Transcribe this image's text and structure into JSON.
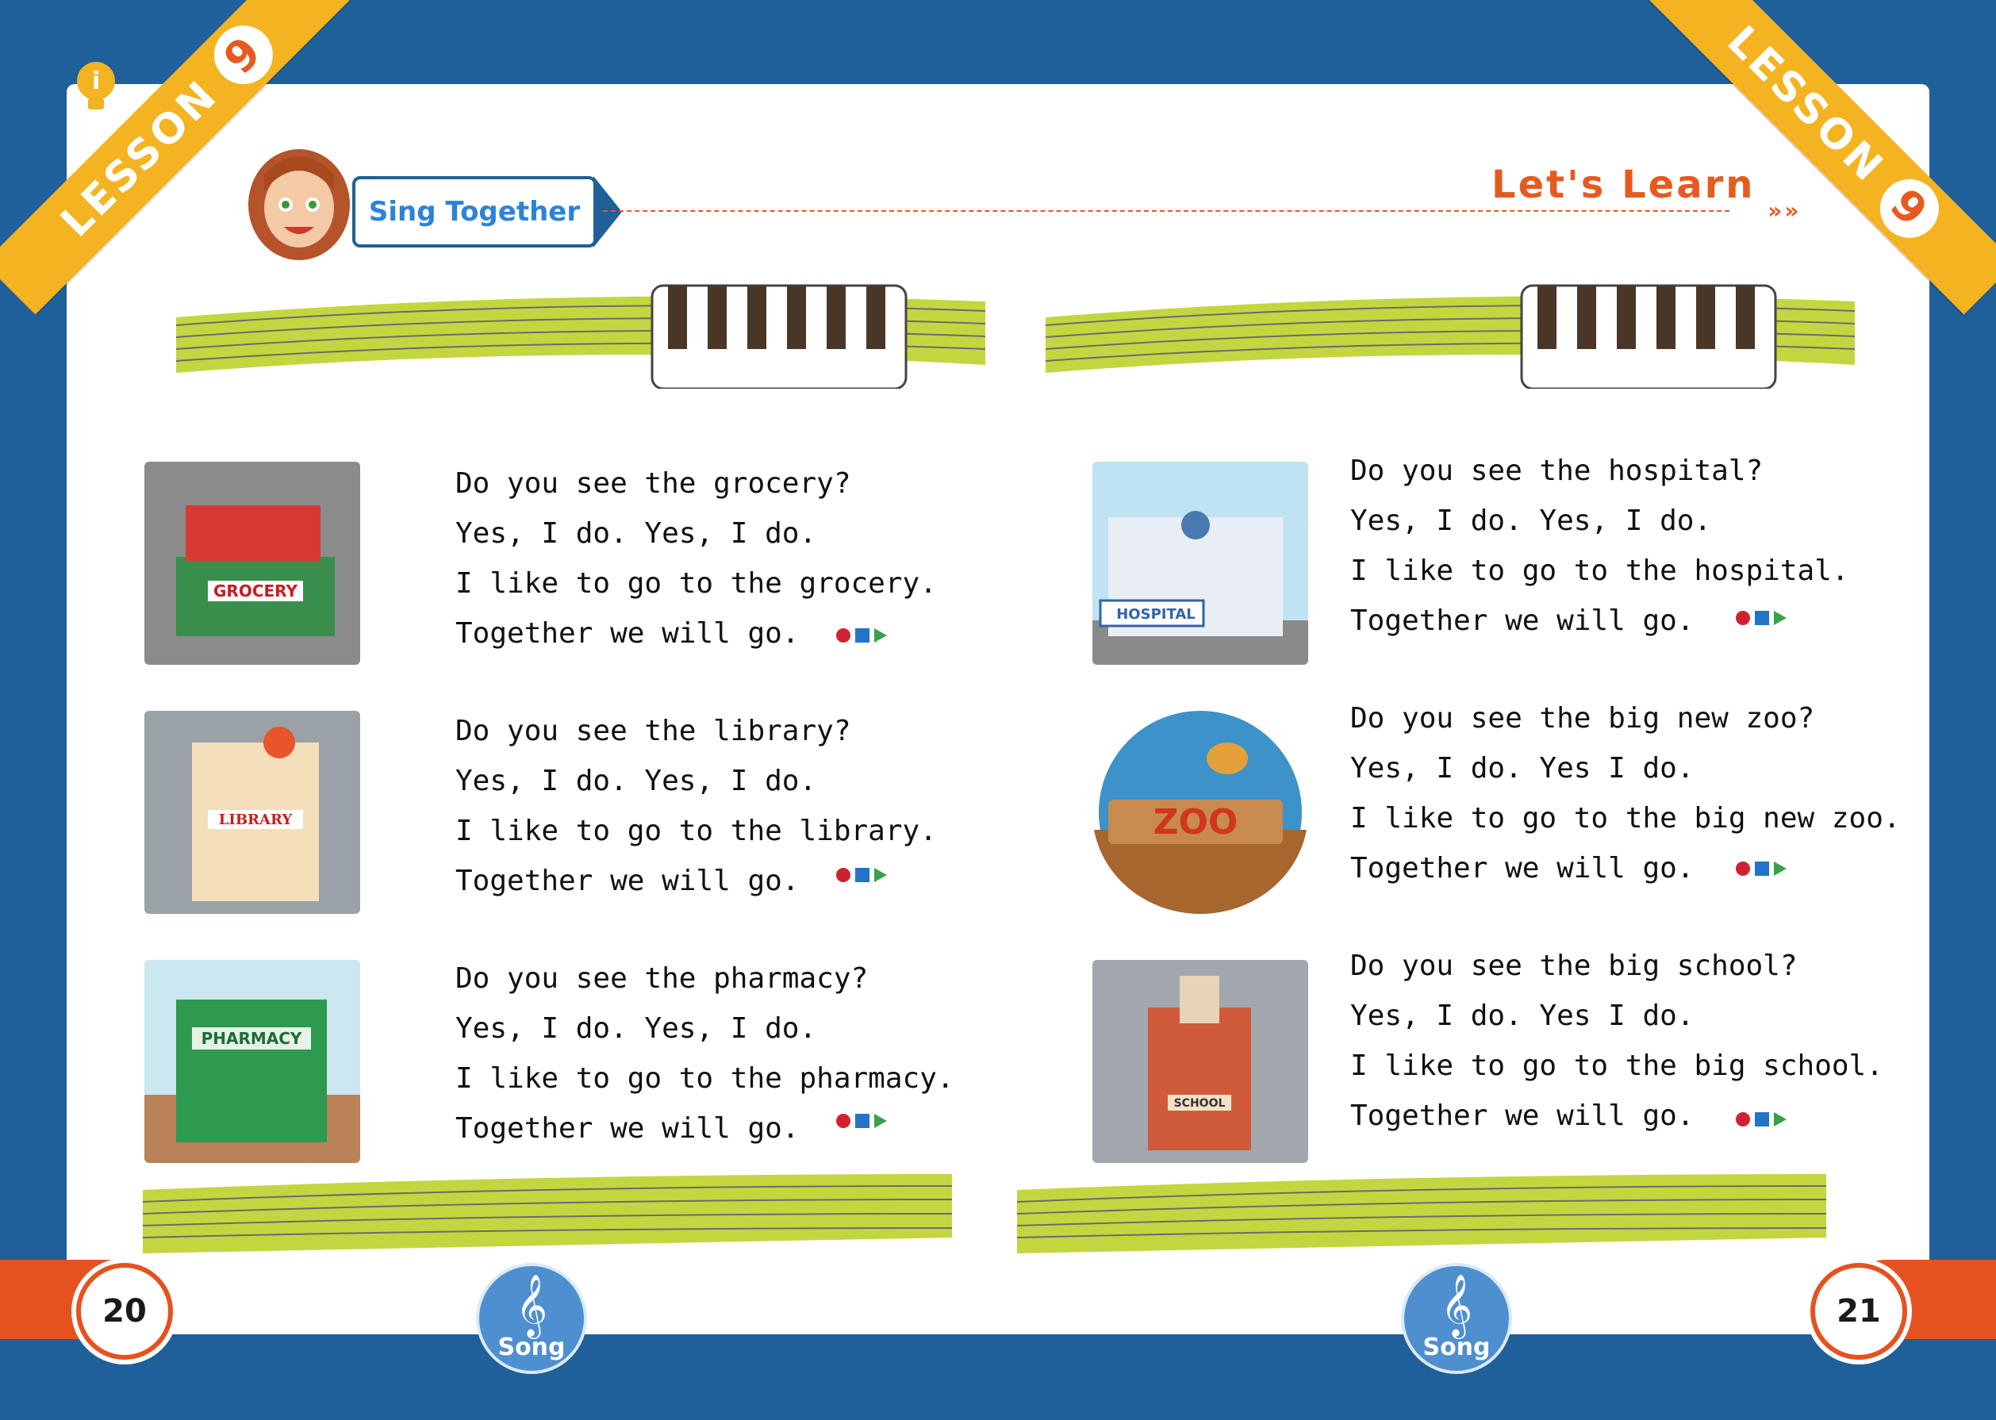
{
  "lesson": {
    "label": "LESSON",
    "number": "9"
  },
  "header": {
    "section_title": "Sing Together",
    "right_title": "Let's Learn",
    "right_arrows": "»»"
  },
  "left": {
    "verses": [
      {
        "name": "grocery",
        "sign": "GROCERY",
        "lines": [
          "Do you see the grocery?",
          "Yes, I do. Yes, I do.",
          "I like to go to the grocery.",
          "Together we will go."
        ]
      },
      {
        "name": "library",
        "sign": "LIBRARY",
        "lines": [
          "Do you see the library?",
          "Yes, I do. Yes, I do.",
          "I like to go to the library.",
          "Together we will go."
        ]
      },
      {
        "name": "pharmacy",
        "sign": "PHARMACY",
        "lines": [
          "Do you see the pharmacy?",
          "Yes, I do. Yes, I do.",
          "I like to go to the pharmacy.",
          "Together we will go."
        ]
      }
    ],
    "page_number": "20",
    "song_label": "Song"
  },
  "right": {
    "verses": [
      {
        "name": "hospital",
        "sign": "HOSPITAL",
        "lines": [
          "Do you see the hospital?",
          "Yes, I do. Yes, I do.",
          "I like to go to the hospital.",
          "Together we will go."
        ]
      },
      {
        "name": "zoo",
        "sign": "ZOO",
        "lines": [
          "Do you see the big new zoo?",
          "Yes, I do. Yes I do.",
          "I like to go to the big new zoo.",
          "Together we will go."
        ]
      },
      {
        "name": "school",
        "sign": "SCHOOL",
        "lines": [
          "Do you see the big school?",
          "Yes, I do. Yes I do.",
          "I like to go to the big school.",
          "Together we will go."
        ]
      }
    ],
    "page_number": "21",
    "song_label": "Song"
  },
  "colors": {
    "frame": "#1f5f9a",
    "ribbon": "#f4b320",
    "accent": "#e65a1f",
    "staff": "#c3d640"
  }
}
